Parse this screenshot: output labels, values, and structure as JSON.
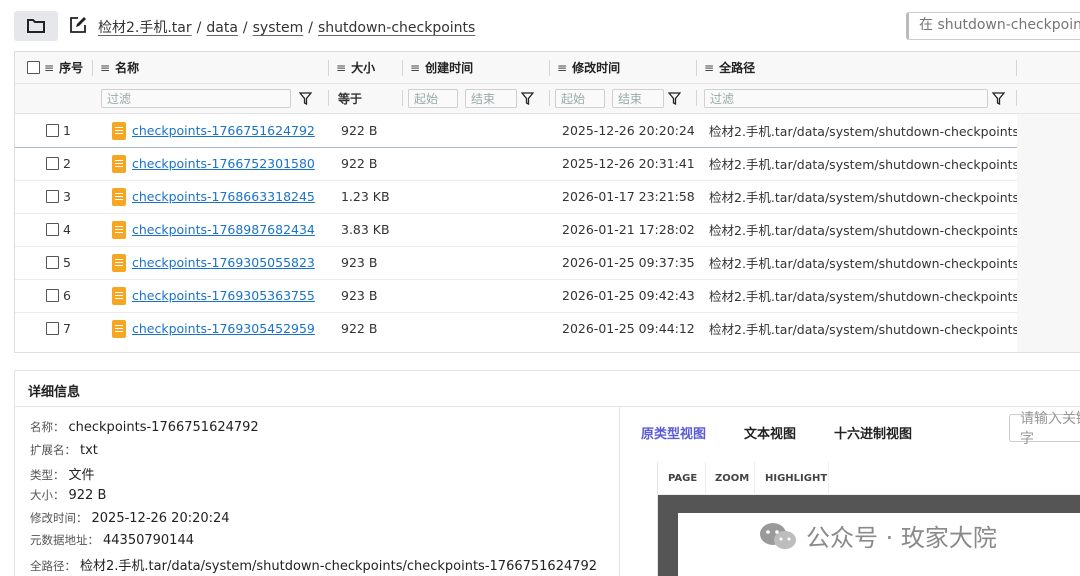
{
  "breadcrumb": {
    "root": "检材2.手机.tar",
    "parts": [
      "data",
      "system",
      "shutdown-checkpoints"
    ],
    "separator": "/"
  },
  "search": {
    "placeholder": "在 shutdown-checkpoints 中搜索"
  },
  "table": {
    "headers": {
      "index": "序号",
      "name": "名称",
      "size": "大小",
      "created": "创建时间",
      "modified": "修改时间",
      "fullpath": "全路径"
    },
    "filters": {
      "name_placeholder": "过滤",
      "size_op": "等于",
      "created_start": "起始",
      "created_end": "结束",
      "modified_start": "起始",
      "modified_end": "结束",
      "path_placeholder": "过滤"
    },
    "rows": [
      {
        "index": "1",
        "name": "checkpoints-1766751624792",
        "size": "922 B",
        "created": "",
        "modified": "2025-12-26 20:20:24",
        "path": "检材2.手机.tar/data/system/shutdown-checkpoints..."
      },
      {
        "index": "2",
        "name": "checkpoints-1766752301580",
        "size": "922 B",
        "created": "",
        "modified": "2025-12-26 20:31:41",
        "path": "检材2.手机.tar/data/system/shutdown-checkpoints..."
      },
      {
        "index": "3",
        "name": "checkpoints-1768663318245",
        "size": "1.23 KB",
        "created": "",
        "modified": "2026-01-17 23:21:58",
        "path": "检材2.手机.tar/data/system/shutdown-checkpoints..."
      },
      {
        "index": "4",
        "name": "checkpoints-1768987682434",
        "size": "3.83 KB",
        "created": "",
        "modified": "2026-01-21 17:28:02",
        "path": "检材2.手机.tar/data/system/shutdown-checkpoints..."
      },
      {
        "index": "5",
        "name": "checkpoints-1769305055823",
        "size": "923 B",
        "created": "",
        "modified": "2026-01-25 09:37:35",
        "path": "检材2.手机.tar/data/system/shutdown-checkpoints..."
      },
      {
        "index": "6",
        "name": "checkpoints-1769305363755",
        "size": "923 B",
        "created": "",
        "modified": "2026-01-25 09:42:43",
        "path": "检材2.手机.tar/data/system/shutdown-checkpoints..."
      },
      {
        "index": "7",
        "name": "checkpoints-1769305452959",
        "size": "922 B",
        "created": "",
        "modified": "2026-01-25 09:44:12",
        "path": "检材2.手机.tar/data/system/shutdown-checkpoints..."
      }
    ]
  },
  "details": {
    "title": "详细信息",
    "fields": [
      {
        "key": "名称：",
        "value": "checkpoints-1766751624792"
      },
      {
        "key": "扩展名：",
        "value": "txt"
      },
      {
        "key": "类型：",
        "value": "文件"
      },
      {
        "key": "大小：",
        "value": "922 B"
      },
      {
        "key": "修改时间：",
        "value": "2025-12-26 20:20:24"
      },
      {
        "key": "元数据地址：",
        "value": "44350790144"
      },
      {
        "key": "全路径：",
        "value": "检材2.手机.tar/data/system/shutdown-checkpoints/checkpoints-1766751624792"
      }
    ],
    "tabs": [
      "原类型视图",
      "文本视图",
      "十六进制视图"
    ],
    "active_tab": "原类型视图",
    "keyword_placeholder": "请输入关键字",
    "viewer_toolbar": [
      "PAGE",
      "ZOOM",
      "HIGHLIGHT"
    ]
  },
  "watermark": {
    "text": "公众号 · 玫家大院"
  },
  "colors": {
    "accent": "#5b5bd6",
    "link": "#1a73c9",
    "file_icon": "#f5a623"
  }
}
